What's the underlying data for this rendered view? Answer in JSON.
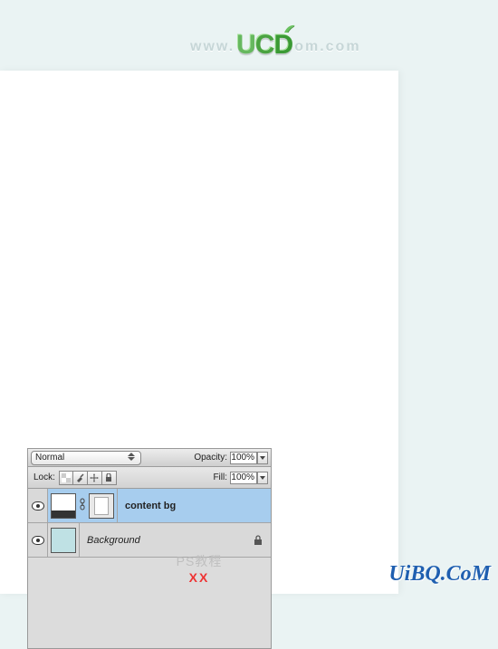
{
  "header": {
    "url_left": "www.",
    "logo_U": "U",
    "logo_C": "C",
    "logo_D": "D",
    "url_right": "om.com"
  },
  "panel": {
    "blend_mode": "Normal",
    "opacity_label": "Opacity:",
    "opacity_value": "100%",
    "lock_label": "Lock:",
    "fill_label": "Fill:",
    "fill_value": "100%",
    "lock_icons": {
      "transparent": "lock-transparent-icon",
      "brush": "lock-pixels-icon",
      "move": "lock-position-icon",
      "all": "lock-all-icon"
    }
  },
  "layers": [
    {
      "visible": true,
      "name": "content bg",
      "selected": true,
      "has_mask": true,
      "linked_mask": true,
      "thumb_kind": "canvas",
      "locked": false
    },
    {
      "visible": true,
      "name": "Background",
      "selected": false,
      "has_mask": false,
      "thumb_kind": "bg",
      "locked": true
    }
  ],
  "footer": {
    "line1": "PS教程",
    "line2": "XX"
  },
  "watermark": "UiBQ.CoM"
}
